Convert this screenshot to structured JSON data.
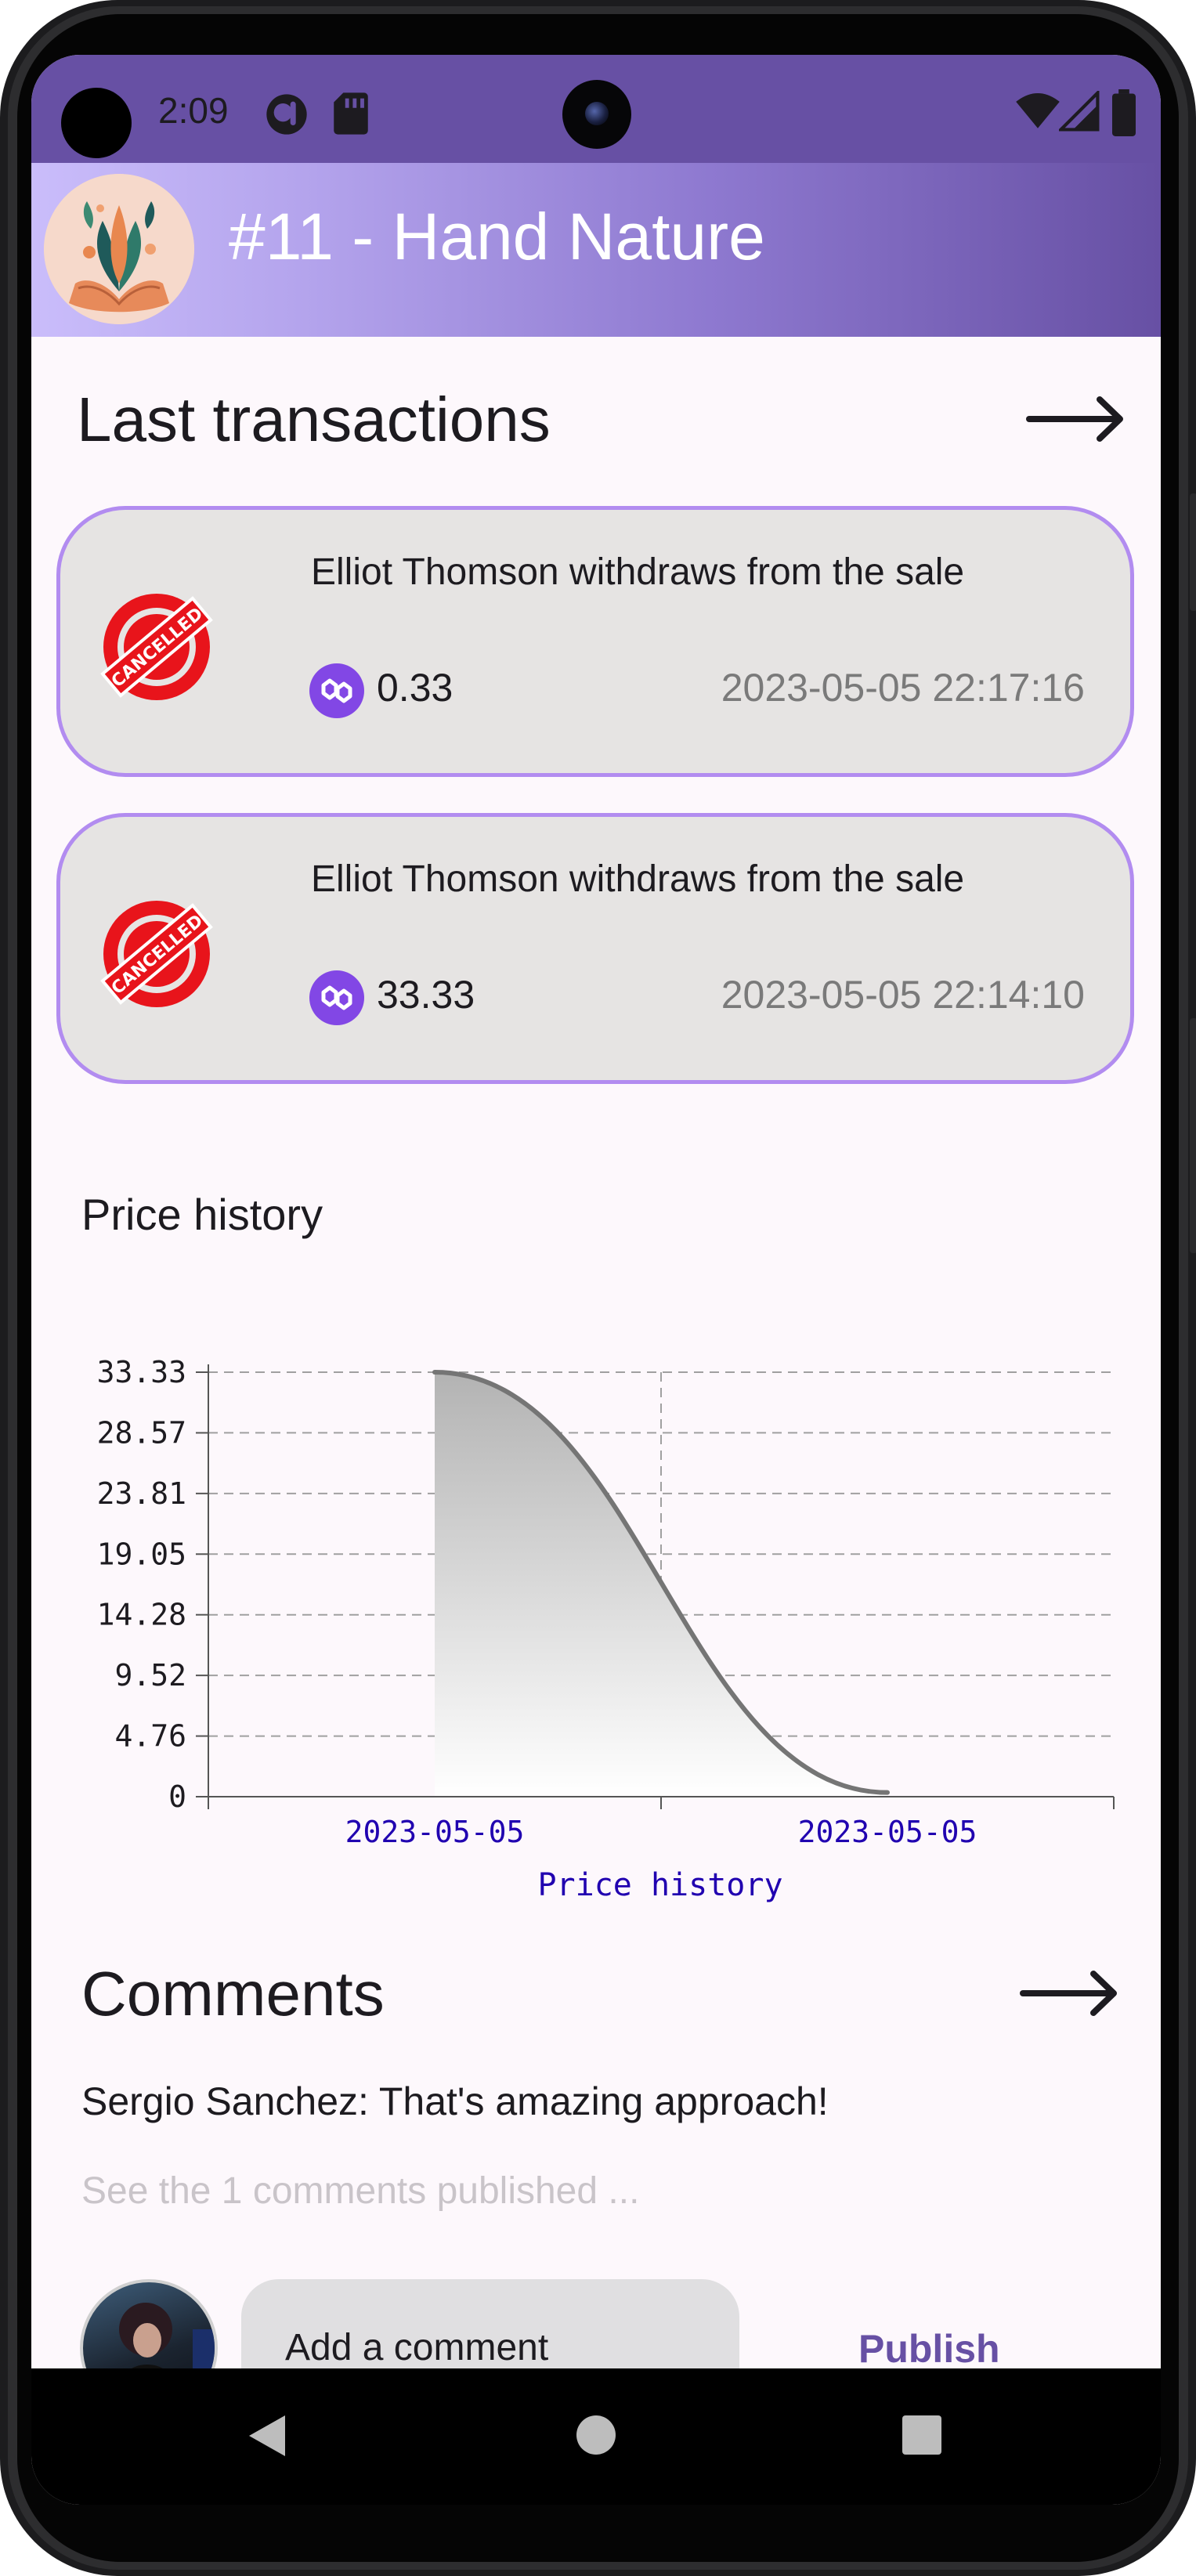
{
  "status_bar": {
    "time": "2:09",
    "icons": [
      "cast-icon",
      "sd-card-icon",
      "wifi-icon",
      "signal-icon",
      "battery-icon"
    ]
  },
  "app_bar": {
    "title": "#11 - Hand Nature",
    "avatar": "nft-thumbnail-hands-plants"
  },
  "transactions": {
    "heading": "Last transactions",
    "more_icon": "arrow-right-icon",
    "items": [
      {
        "status_icon": "cancelled-stamp-icon",
        "stamp_text": "CANCELLED",
        "description": "Elliot Thomson withdraws from the sale",
        "token_icon": "polygon-matic-icon",
        "amount": "0.33",
        "date": "2023-05-05 22:17:16"
      },
      {
        "status_icon": "cancelled-stamp-icon",
        "stamp_text": "CANCELLED",
        "description": "Elliot Thomson withdraws from the sale",
        "token_icon": "polygon-matic-icon",
        "amount": "33.33",
        "date": "2023-05-05 22:14:10"
      }
    ]
  },
  "price_history": {
    "heading": "Price history"
  },
  "chart_data": {
    "type": "area",
    "title": "",
    "xlabel": "Price history",
    "ylabel": "",
    "x": [
      "2023-05-05 22:14:10",
      "2023-05-05 22:17:16"
    ],
    "x_tick_labels": [
      "2023-05-05",
      "2023-05-05"
    ],
    "y_tick_labels": [
      "0",
      "4.76",
      "9.52",
      "14.28",
      "19.05",
      "23.81",
      "28.57",
      "33.33"
    ],
    "values": [
      33.33,
      0.33
    ],
    "ylim": [
      0,
      33.33
    ],
    "grid": true,
    "smooth": true,
    "colors": {
      "line": "#757575",
      "fill_top": "#b3b3b3",
      "fill_bottom": "#ffffff",
      "tick_label_x": "#2000b0",
      "axis_label": "#2000b0"
    }
  },
  "comments": {
    "heading": "Comments",
    "more_icon": "arrow-right-icon",
    "first_comment": "Sergio Sanchez: That's amazing approach!",
    "see_all": "See the 1 comments published ...",
    "input_placeholder": "Add a comment",
    "publish_label": "Publish",
    "avatar": "user-avatar"
  },
  "nav_bar": {
    "back_icon": "nav-back-icon",
    "home_icon": "nav-home-icon",
    "recents_icon": "nav-recents-icon"
  },
  "colors": {
    "primary": "#6750a4",
    "card_border": "#b28cf0",
    "card_bg": "#e6e4e3",
    "cancel_red": "#e8141b",
    "token_purple": "#8247e5",
    "background": "#fdf8fc"
  }
}
